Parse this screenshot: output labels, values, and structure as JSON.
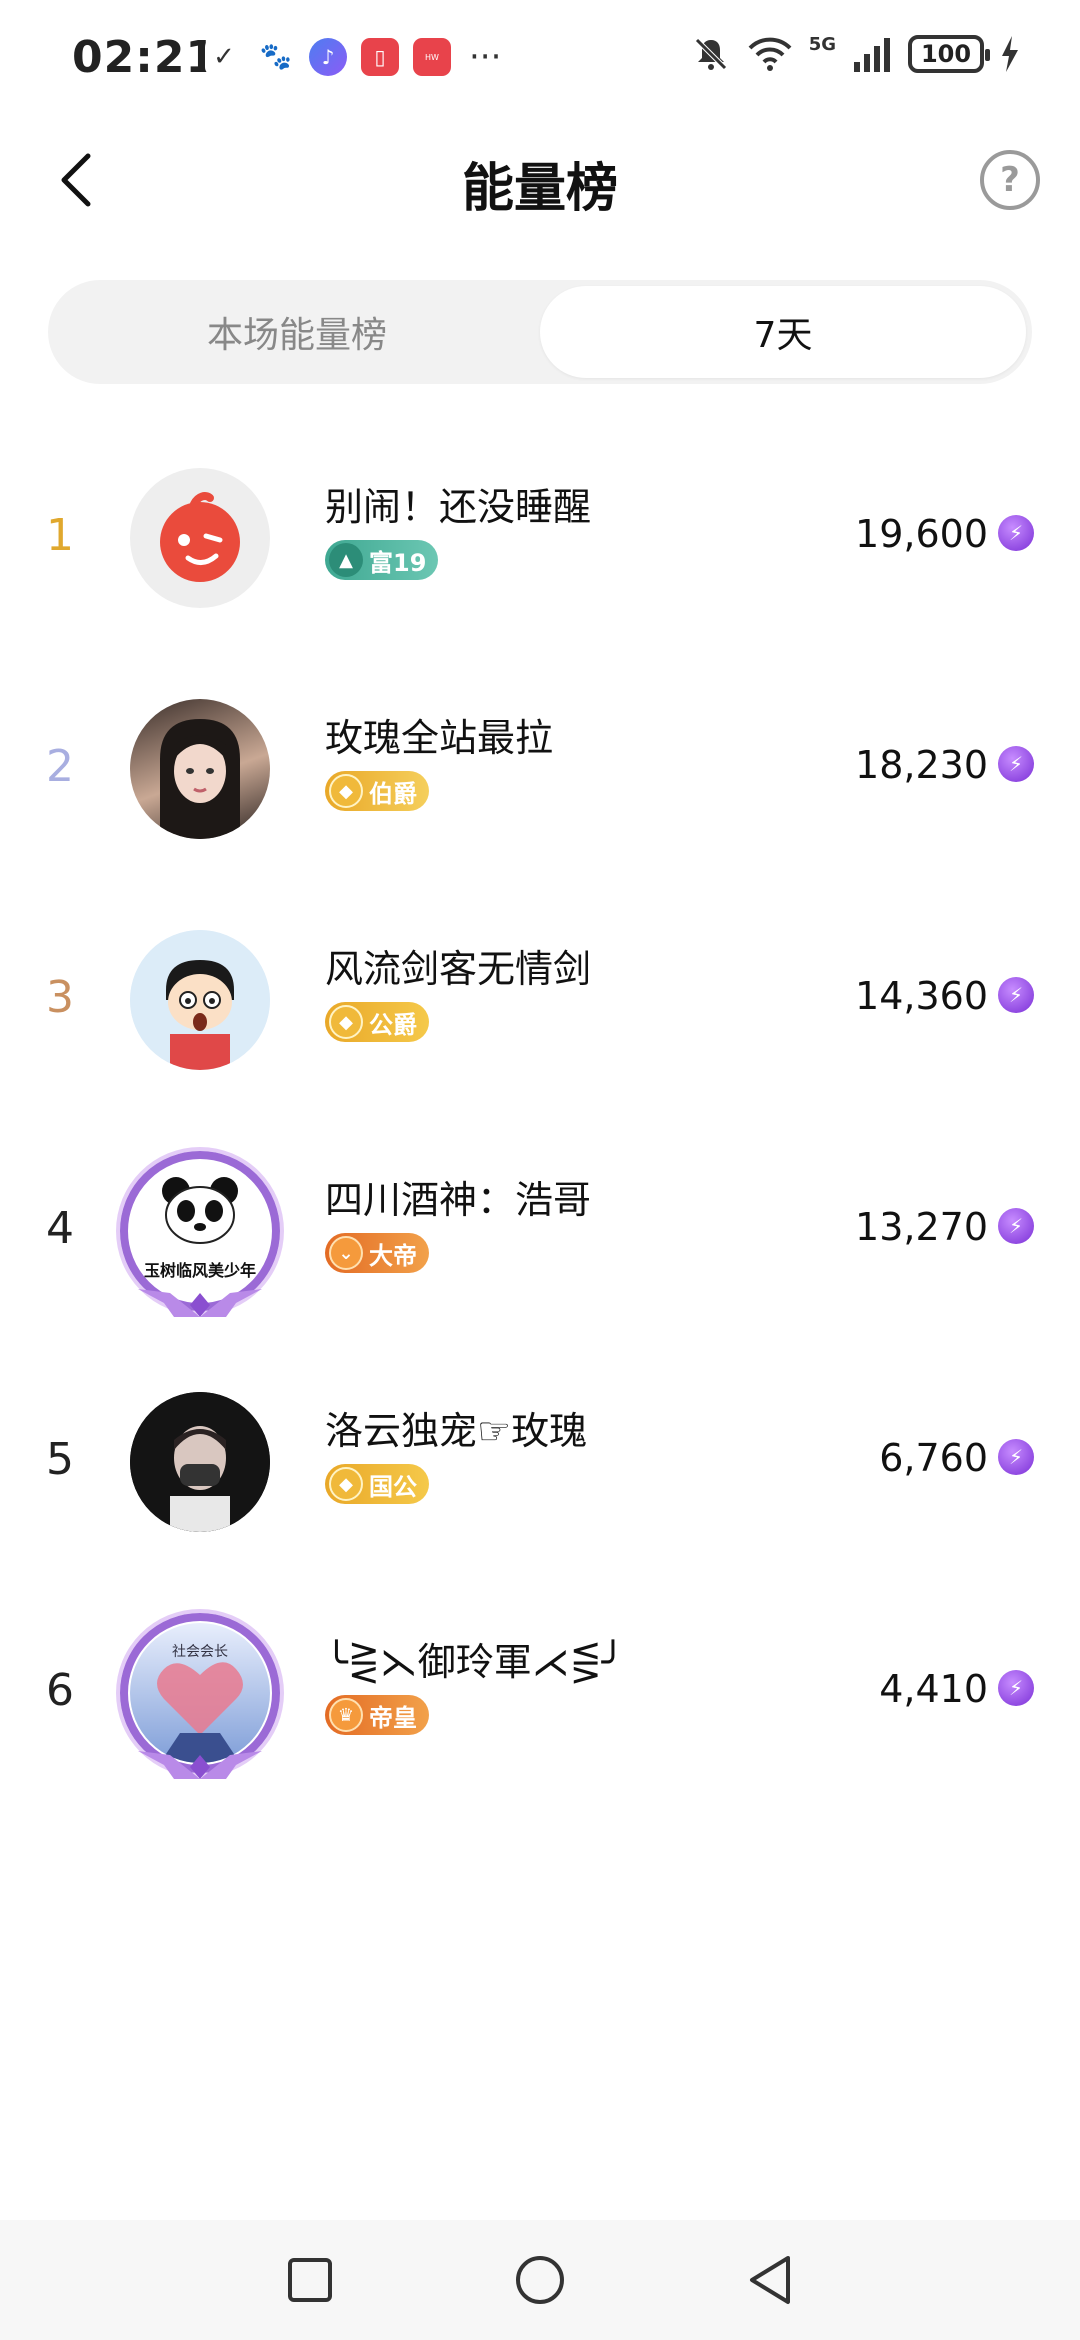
{
  "status_bar": {
    "time": "02:21",
    "network": "5G",
    "battery": "100"
  },
  "header": {
    "title": "能量榜",
    "help_icon": "?"
  },
  "tabs": [
    {
      "label": "本场能量榜",
      "active": false
    },
    {
      "label": "7天",
      "active": true
    }
  ],
  "ranking": [
    {
      "rank": "1",
      "rank_color": "#e0a82e",
      "name": "别闹！还没睡醒",
      "badge": "富19",
      "badge_color": "#4bb3a0",
      "score": "19,600"
    },
    {
      "rank": "2",
      "rank_color": "#a8aee0",
      "name": "玫瑰全站最拉",
      "badge": "伯爵",
      "badge_color": "#e8b13a",
      "score": "18,230"
    },
    {
      "rank": "3",
      "rank_color": "#c99060",
      "name": "风流剑客无情剑",
      "badge": "公爵",
      "badge_color": "#e8a932",
      "score": "14,360"
    },
    {
      "rank": "4",
      "rank_color": "#222222",
      "name": "四川酒神：浩哥",
      "badge": "大帝",
      "badge_color": "#e8822e",
      "score": "13,270"
    },
    {
      "rank": "5",
      "rank_color": "#222222",
      "name": "洛云独宠☞玫瑰",
      "badge": "国公",
      "badge_color": "#e8a932",
      "score": "6,760"
    },
    {
      "rank": "6",
      "rank_color": "#222222",
      "name": "╰⋛⋋御玲軍⋌⋚╯",
      "badge": "帝皇",
      "badge_color": "#e8822e",
      "score": "4,410"
    }
  ],
  "avatar_4_text": "玉树临风美少年",
  "avatar_6_text": "社会会长"
}
